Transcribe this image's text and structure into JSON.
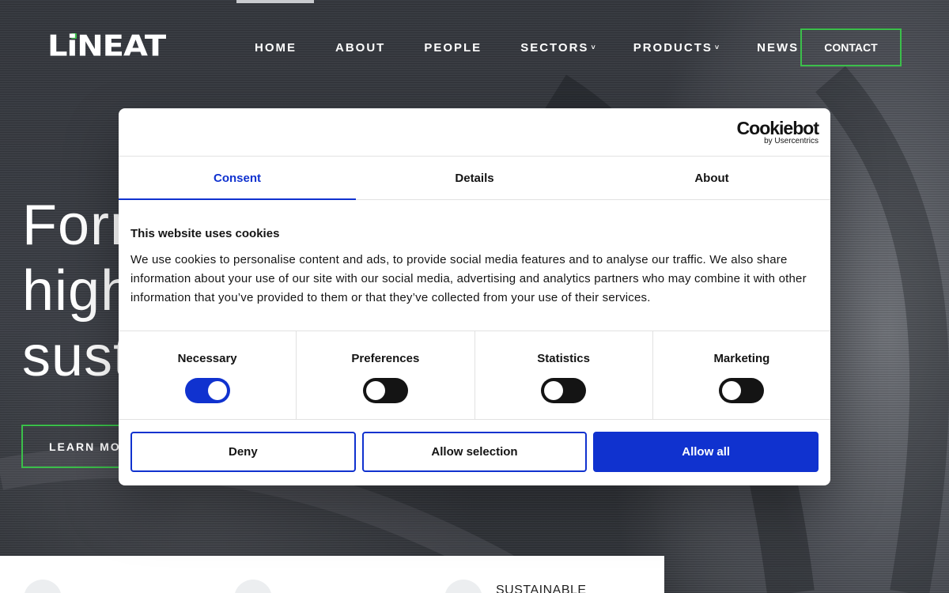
{
  "header": {
    "logo_text": "LiNEAT",
    "nav": [
      {
        "label": "HOME",
        "has_dropdown": false
      },
      {
        "label": "ABOUT",
        "has_dropdown": false
      },
      {
        "label": "PEOPLE",
        "has_dropdown": false
      },
      {
        "label": "SECTORS",
        "has_dropdown": true
      },
      {
        "label": "PRODUCTS",
        "has_dropdown": true
      },
      {
        "label": "NEWS",
        "has_dropdown": false
      }
    ],
    "contact_label": "CONTACT"
  },
  "hero": {
    "title_visible": "Forn\nhigh\nsust",
    "learn_more_label": "LEARN MOR"
  },
  "features": {
    "label_3": "SUSTAINABLE"
  },
  "cookie": {
    "brand": "Cookiebot",
    "brand_sub": "by Usercentrics",
    "tabs": [
      {
        "label": "Consent",
        "active": true
      },
      {
        "label": "Details",
        "active": false
      },
      {
        "label": "About",
        "active": false
      }
    ],
    "heading": "This website uses cookies",
    "body": "We use cookies to personalise content and ads, to provide social media features and to analyse our traffic. We also share information about your use of our site with our social media, advertising and analytics partners who may combine it with other information that you’ve provided to them or that they’ve collected from your use of their services.",
    "toggles": [
      {
        "label": "Necessary",
        "on": true
      },
      {
        "label": "Preferences",
        "on": false
      },
      {
        "label": "Statistics",
        "on": false
      },
      {
        "label": "Marketing",
        "on": false
      }
    ],
    "buttons": {
      "deny": "Deny",
      "allow_selection": "Allow selection",
      "allow_all": "Allow all"
    }
  },
  "colors": {
    "accent_green": "#3bbf4a",
    "cookiebot_blue": "#1032cf",
    "dialog_text": "#141414"
  }
}
